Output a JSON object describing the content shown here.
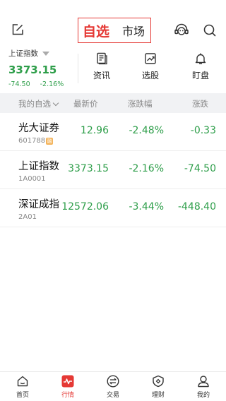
{
  "header": {
    "tabs": [
      {
        "label": "自选",
        "active": true
      },
      {
        "label": "市场",
        "active": false
      }
    ],
    "icons": {
      "edit": "edit-icon",
      "service": "customer-service-icon",
      "search": "search-icon"
    }
  },
  "index": {
    "name": "上证指数",
    "value": "3373.15",
    "change": "-74.50",
    "change_pct": "-2.16%"
  },
  "quick_nav": [
    {
      "label": "资讯",
      "icon": "news-icon"
    },
    {
      "label": "选股",
      "icon": "stock-picker-icon"
    },
    {
      "label": "盯盘",
      "icon": "bell-icon"
    }
  ],
  "table": {
    "headers": {
      "name": "我的自选",
      "price": "最新价",
      "pct": "涨跌幅",
      "chg": "涨跌"
    },
    "rows": [
      {
        "name": "光大证券",
        "code": "601788",
        "badge": "融",
        "price": "12.96",
        "pct": "-2.48%",
        "chg": "-0.33"
      },
      {
        "name": "上证指数",
        "code": "1A0001",
        "badge": "",
        "price": "3373.15",
        "pct": "-2.16%",
        "chg": "-74.50"
      },
      {
        "name": "深证成指",
        "code": "2A01",
        "badge": "",
        "price": "12572.06",
        "pct": "-3.44%",
        "chg": "-448.40"
      }
    ]
  },
  "tabbar": [
    {
      "label": "首页",
      "icon": "home-icon",
      "active": false
    },
    {
      "label": "行情",
      "icon": "market-icon",
      "active": true
    },
    {
      "label": "交易",
      "icon": "trade-icon",
      "active": false
    },
    {
      "label": "理财",
      "icon": "finance-icon",
      "active": false
    },
    {
      "label": "我的",
      "icon": "profile-icon",
      "active": false
    }
  ],
  "colors": {
    "accent": "#e53935",
    "down": "#2e9e4a",
    "header_bg": "#f1f2f4"
  }
}
